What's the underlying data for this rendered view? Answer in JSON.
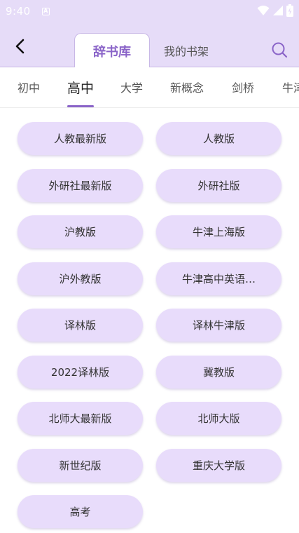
{
  "status_bar": {
    "time": "9:40",
    "notif_glyph": "A"
  },
  "header": {
    "back_icon": "chevron-left-icon",
    "tabs": [
      {
        "label": "辞书库",
        "active": true
      },
      {
        "label": "我的书架",
        "active": false
      }
    ],
    "search_icon": "search-icon"
  },
  "categories": [
    {
      "label": "初中",
      "active": false
    },
    {
      "label": "高中",
      "active": true
    },
    {
      "label": "大学",
      "active": false
    },
    {
      "label": "新概念",
      "active": false
    },
    {
      "label": "剑桥",
      "active": false
    },
    {
      "label": "牛津",
      "active": false
    }
  ],
  "books": [
    "人教最新版",
    "人教版",
    "外研社最新版",
    "外研社版",
    "沪教版",
    "牛津上海版",
    "沪外教版",
    "牛津高中英语…",
    "译林版",
    "译林牛津版",
    "2022译林版",
    "冀教版",
    "北师大最新版",
    "北师大版",
    "新世纪版",
    "重庆大学版",
    "高考"
  ],
  "colors": {
    "header_bg": "#e6dcf8",
    "accent": "#8a64c8",
    "button_bg": "#e8dcfb"
  }
}
